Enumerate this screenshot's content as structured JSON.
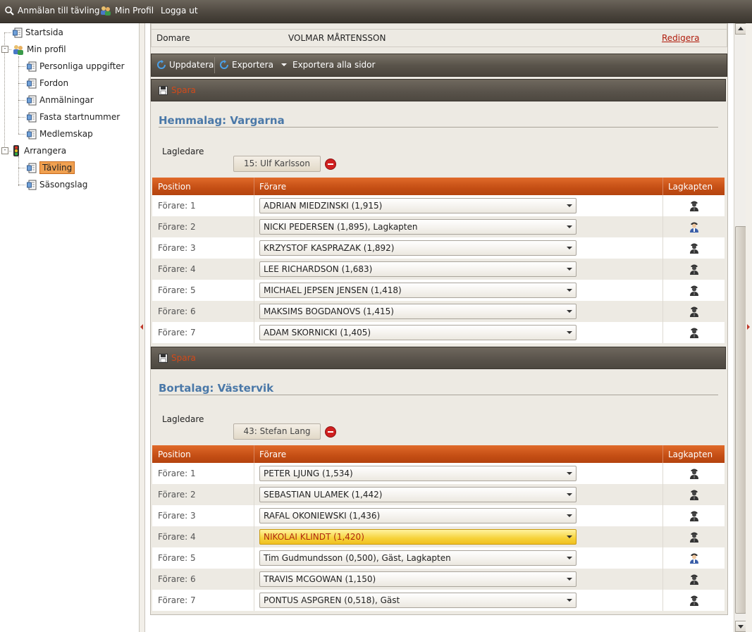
{
  "topbar": {
    "items": [
      {
        "label": "Anmälan till tävling",
        "icon": "search-icon"
      },
      {
        "label": "Min Profil",
        "icon": "users-icon"
      },
      {
        "label": "Logga ut",
        "icon": ""
      }
    ]
  },
  "sidebar": {
    "items": [
      {
        "label": "Startsida",
        "icon": "page-icon"
      },
      {
        "label": "Min profil",
        "icon": "users-icon"
      },
      {
        "label": "Personliga uppgifter",
        "icon": "page-icon"
      },
      {
        "label": "Fordon",
        "icon": "page-icon"
      },
      {
        "label": "Anmälningar",
        "icon": "page-icon"
      },
      {
        "label": "Fasta startnummer",
        "icon": "page-icon"
      },
      {
        "label": "Medlemskap",
        "icon": "page-icon"
      },
      {
        "label": "Arrangera",
        "icon": "traffic-light-icon"
      },
      {
        "label": "Tävling",
        "icon": "page-icon",
        "selected": true
      },
      {
        "label": "Säsongslag",
        "icon": "page-icon"
      }
    ]
  },
  "info": {
    "domare_label": "Domare",
    "domare_value": "VOLMAR MÅRTENSSON",
    "edit_label": "Redigera"
  },
  "toolbar": {
    "update_label": "Uppdatera",
    "export_label": "Exportera",
    "export_all_label": "Exportera alla sidor"
  },
  "save_label": "Spara",
  "columns": {
    "position": "Position",
    "driver": "Förare",
    "captain": "Lagkapten"
  },
  "lagledare_label": "Lagledare",
  "home": {
    "title": "Hemmalag: Vargarna",
    "leader": "15: Ulf Karlsson",
    "rows": [
      {
        "position": "Förare: 1",
        "driver": "ADRIAN MIEDZINSKI (1,915)",
        "captain": false
      },
      {
        "position": "Förare: 2",
        "driver": "NICKI PEDERSEN (1,895), Lagkapten",
        "captain": true
      },
      {
        "position": "Förare: 3",
        "driver": "KRZYSTOF KASPRAZAK (1,892)",
        "captain": false
      },
      {
        "position": "Förare: 4",
        "driver": "LEE RICHARDSON (1,683)",
        "captain": false
      },
      {
        "position": "Förare: 5",
        "driver": "MICHAEL JEPSEN JENSEN (1,418)",
        "captain": false
      },
      {
        "position": "Förare: 6",
        "driver": "MAKSIMS BOGDANOVS (1,415)",
        "captain": false
      },
      {
        "position": "Förare: 7",
        "driver": "ADAM SKORNICKI (1,405)",
        "captain": false
      }
    ]
  },
  "away": {
    "title": "Bortalag: Västervik",
    "leader": "43: Stefan Lang",
    "rows": [
      {
        "position": "Förare: 1",
        "driver": "PETER LJUNG (1,534)",
        "captain": false
      },
      {
        "position": "Förare: 2",
        "driver": "SEBASTIAN ULAMEK (1,442)",
        "captain": false
      },
      {
        "position": "Förare: 3",
        "driver": "RAFAL OKONIEWSKI (1,436)",
        "captain": false
      },
      {
        "position": "Förare: 4",
        "driver": "NIKOLAI KLINDT (1,420)",
        "captain": false,
        "highlighted": true
      },
      {
        "position": "Förare: 5",
        "driver": "Tim Gudmundsson (0,500), Gäst, Lagkapten",
        "captain": true
      },
      {
        "position": "Förare: 6",
        "driver": "TRAVIS MCGOWAN (1,150)",
        "captain": false
      },
      {
        "position": "Förare: 7",
        "driver": "PONTUS ASPGREN (0,518), Gäst",
        "captain": false
      }
    ]
  }
}
